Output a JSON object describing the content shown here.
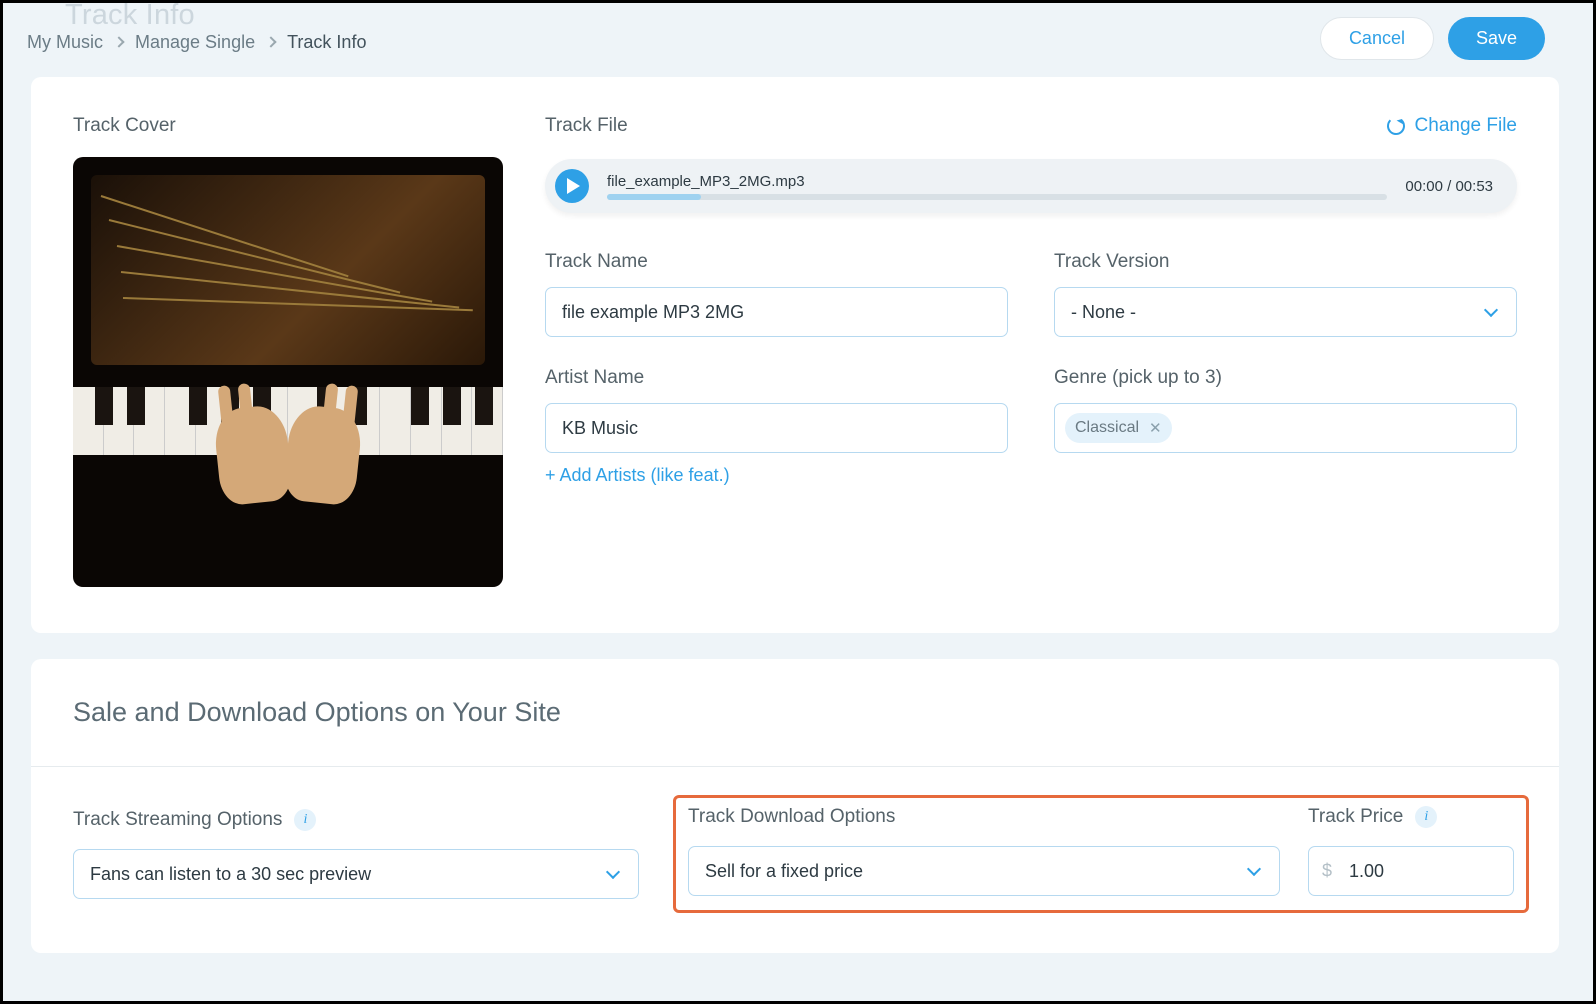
{
  "page": {
    "backgroundTitle": "Track Info"
  },
  "breadcrumb": {
    "items": [
      "My Music",
      "Manage Single",
      "Track Info"
    ]
  },
  "actions": {
    "cancel": "Cancel",
    "save": "Save"
  },
  "trackCover": {
    "label": "Track Cover"
  },
  "trackFile": {
    "label": "Track File",
    "changeFile": "Change File",
    "filename": "file_example_MP3_2MG.mp3",
    "timecode": "00:00 / 00:53"
  },
  "fields": {
    "trackName": {
      "label": "Track Name",
      "value": "file example MP3 2MG"
    },
    "trackVersion": {
      "label": "Track Version",
      "value": "- None -"
    },
    "artistName": {
      "label": "Artist Name",
      "value": "KB Music",
      "addLink": "+ Add Artists (like feat.)"
    },
    "genre": {
      "label": "Genre (pick up to 3)",
      "tags": [
        "Classical"
      ]
    }
  },
  "sale": {
    "title": "Sale and Download Options on Your Site",
    "streaming": {
      "label": "Track Streaming Options",
      "value": "Fans can listen to a 30 sec preview"
    },
    "download": {
      "label": "Track Download Options",
      "value": "Sell for a fixed price"
    },
    "price": {
      "label": "Track Price",
      "currency": "$",
      "value": "1.00"
    }
  }
}
